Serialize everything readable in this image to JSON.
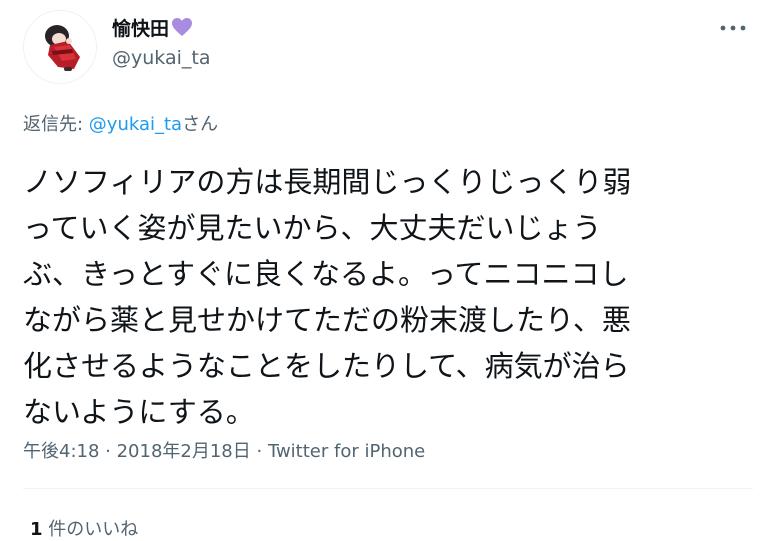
{
  "author": {
    "display_name": "愉快田",
    "emoji_icon": "purple-heart-icon",
    "handle": "@yukai_ta",
    "avatar_icon": "user-avatar"
  },
  "reply": {
    "prefix": "返信先: ",
    "mention": "@yukai_ta",
    "suffix": "さん"
  },
  "tweet": {
    "text": "ノソフィリアの方は長期間じっくりじっくり弱\nっていく姿が見たいから、大丈夫だいじょう\nぶ、きっとすぐに良くなるよ。ってニコニコし\nながら薬と見せかけてただの粉末渡したり、悪\n化させるようなことをしたりして、病気が治ら\nないようにする。"
  },
  "meta": {
    "time": "午後4:18",
    "separator": " · ",
    "date": "2018年2月18日",
    "source": "Twitter for iPhone"
  },
  "engagement": {
    "likes_count": "1",
    "likes_label": " 件のいいね"
  },
  "menu": {
    "more_icon": "more-horizontal-icon"
  },
  "colors": {
    "text": "#0f1419",
    "secondary": "#536471",
    "link": "#1d9bf0",
    "heart": "#a98be0",
    "divider": "#eff3f4"
  }
}
